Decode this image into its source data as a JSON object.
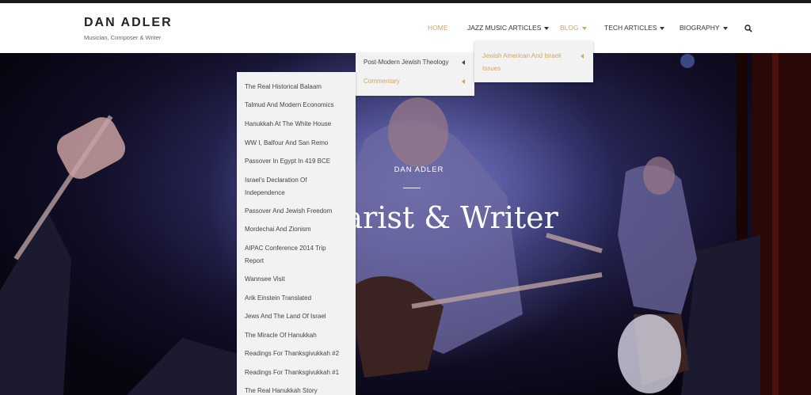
{
  "site": {
    "title": "DAN ADLER",
    "tagline": "Musician, Composer & Writer"
  },
  "nav": {
    "items": [
      {
        "label": "HOME",
        "active": true,
        "has_dropdown": false
      },
      {
        "label": "JAZZ MUSIC ARTICLES",
        "active": false,
        "has_dropdown": true
      },
      {
        "label": "BLOG",
        "active": true,
        "has_dropdown": true
      },
      {
        "label": "TECH ARTICLES",
        "active": false,
        "has_dropdown": true
      },
      {
        "label": "BIOGRAPHY",
        "active": false,
        "has_dropdown": true
      }
    ],
    "search_icon": "search-icon"
  },
  "hero": {
    "subtitle": "DAN ADLER",
    "title": "Guitarist & Writer"
  },
  "blog_menu": {
    "items": [
      {
        "label": "Post-Modern Jewish Theology"
      },
      {
        "label": "Commentary",
        "active": true
      }
    ]
  },
  "jewish_menu": {
    "item": "Jewish American And Israeli Issues"
  },
  "commentary_menu": {
    "items": [
      "The Real Historical Balaam",
      "Talmud And Modern Economics",
      "Hanukkah At The White House",
      "WW I, Balfour And San Remo",
      "Passover In Egypt In 419 BCE",
      "Israel's Declaration Of Independence",
      "Passover And Jewish Freedom",
      "Mordechai And Zionism",
      "AIPAC Conference 2014 Trip Report",
      "Wannsee Visit",
      "Arik Einstein Translated",
      "Jews And The Land Of Israel",
      "The Miracle Of Hanukkah",
      "Readings For Thanksgivukkah #2",
      "Readings For Thanksgivukkah #1",
      "The Real Hanukkah Story"
    ]
  },
  "colors": {
    "accent": "#c9a76a",
    "menu_bg": "#f2f2f2",
    "header_bg": "#ffffff"
  }
}
